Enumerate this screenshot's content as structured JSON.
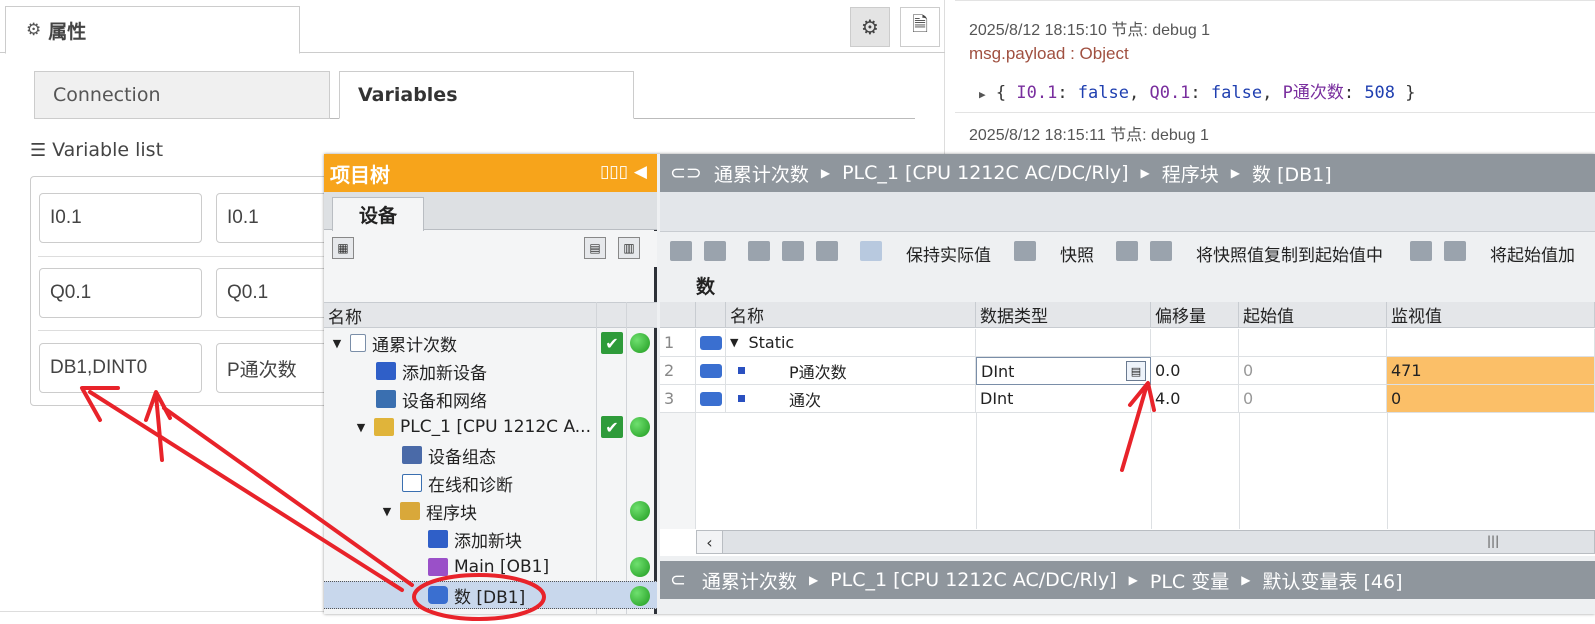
{
  "node_red": {
    "tab_title": "属性",
    "subtabs": {
      "connection": "Connection",
      "variables": "Variables"
    },
    "variable_list_label": "Variable list",
    "variables": [
      {
        "address": "I0.1",
        "name": "I0.1"
      },
      {
        "address": "Q0.1",
        "name": "Q0.1"
      },
      {
        "address": "DB1,DINT0",
        "name": "P通次数"
      }
    ]
  },
  "debug": {
    "messages": [
      {
        "meta": "2025/8/12 18:15:10   节点: debug 1",
        "topic": "msg.payload : Object",
        "object": {
          "k1": "I0.1",
          "v1": "false",
          "k2": "Q0.1",
          "v2": "false",
          "k3": "P通次数",
          "v3": "508"
        }
      },
      {
        "meta": "2025/8/12 18:15:11   节点: debug 1"
      }
    ]
  },
  "tia": {
    "project_tree": {
      "title": "项目树",
      "tab": "设备",
      "column_name": "名称",
      "items": [
        {
          "label": "通累计次数"
        },
        {
          "label": "添加新设备"
        },
        {
          "label": "设备和网络"
        },
        {
          "label": "PLC_1 [CPU 1212C A..."
        },
        {
          "label": "设备组态"
        },
        {
          "label": "在线和诊断"
        },
        {
          "label": "程序块"
        },
        {
          "label": "添加新块"
        },
        {
          "label": "Main [OB1]"
        },
        {
          "label": "数 [DB1]"
        }
      ]
    },
    "editor": {
      "breadcrumb": [
        "通累计次数",
        "PLC_1 [CPU 1212C AC/DC/Rly]",
        "程序块",
        "数 [DB1]"
      ],
      "toolbar": {
        "keep_actual": "保持实际值",
        "snapshot": "快照",
        "copy_snapshot": "将快照值复制到起始值中",
        "load_start": "将起始值加"
      },
      "block_name": "数",
      "columns": {
        "name": "名称",
        "datatype": "数据类型",
        "offset": "偏移量",
        "start": "起始值",
        "monitor": "监视值"
      },
      "rows": [
        {
          "num": "1",
          "name": "Static",
          "datatype": "",
          "offset": "",
          "start": "",
          "monitor": ""
        },
        {
          "num": "2",
          "name": "P通次数",
          "datatype": "DInt",
          "offset": "0.0",
          "start": "0",
          "monitor": "471"
        },
        {
          "num": "3",
          "name": "通次",
          "datatype": "DInt",
          "offset": "4.0",
          "start": "0",
          "monitor": "0"
        }
      ],
      "bottom_breadcrumb": [
        "通累计次数",
        "PLC_1 [CPU 1212C AC/DC/Rly]",
        "PLC 变量",
        "默认变量表 [46]"
      ]
    }
  },
  "colors": {
    "tia_orange": "#f7a41b",
    "monitor_orange": "#fbbf68",
    "annotation_red": "#e8232a"
  }
}
